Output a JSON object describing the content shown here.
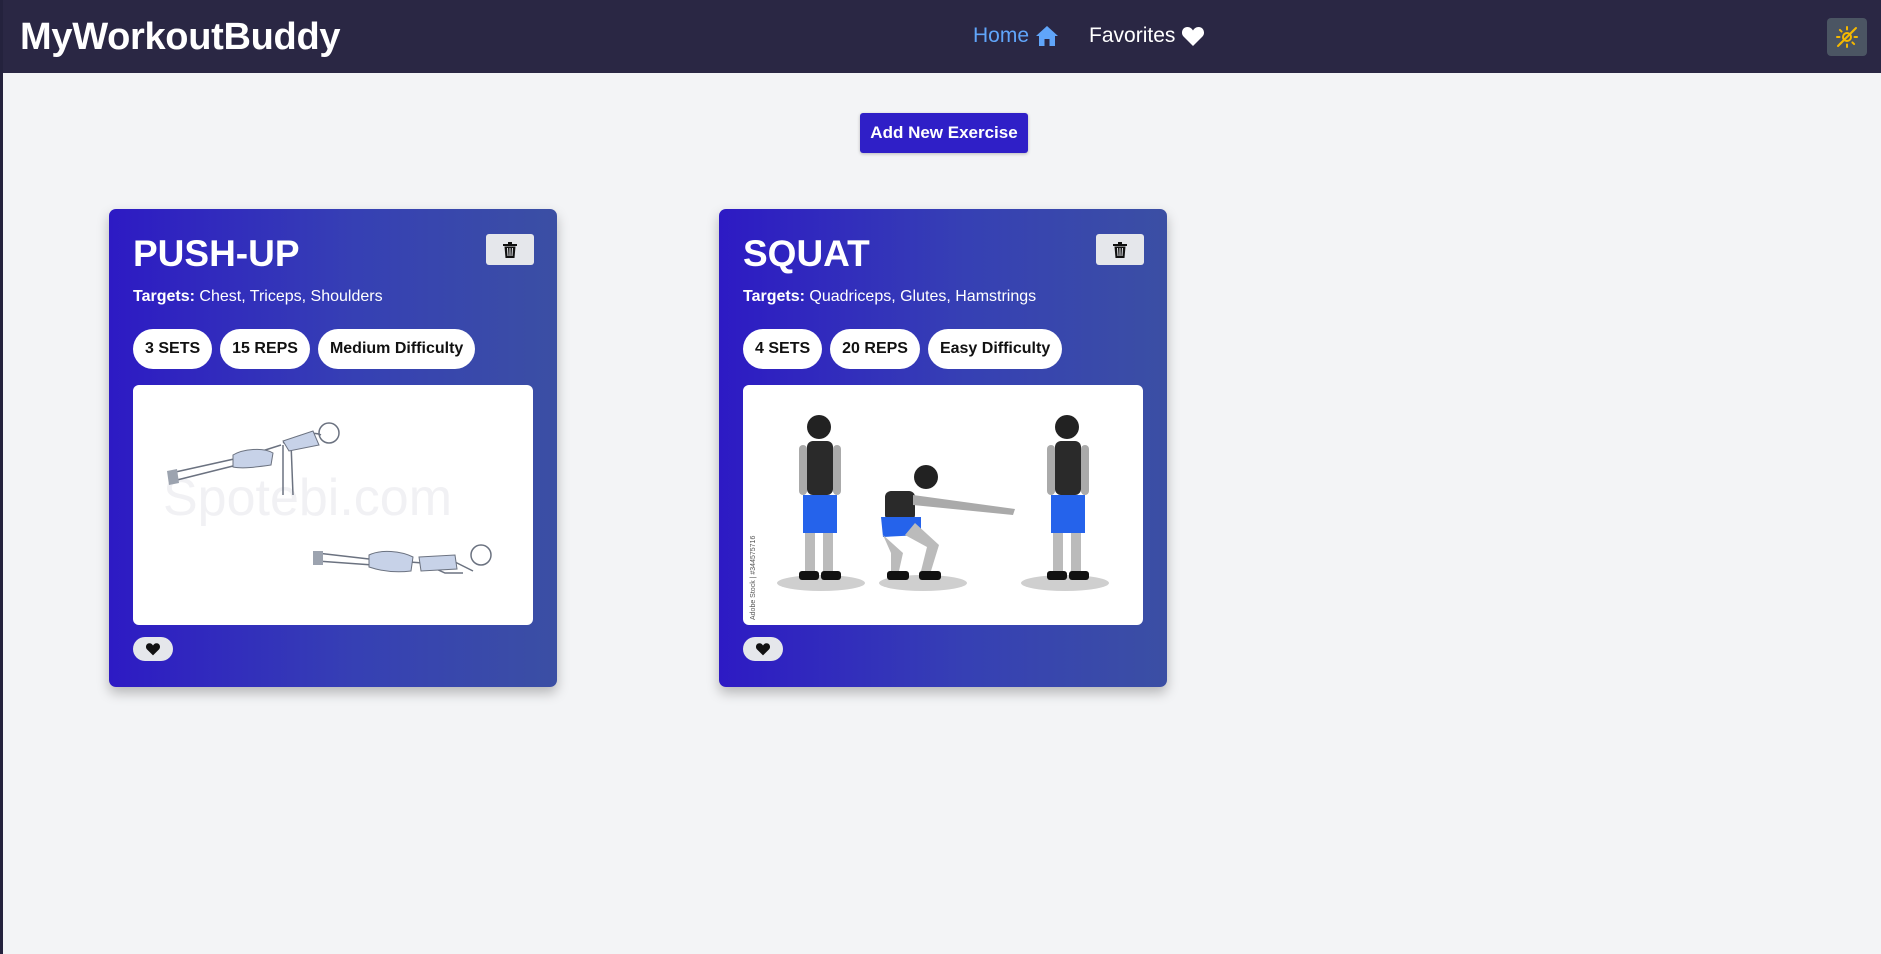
{
  "app": {
    "brand": "MyWorkoutBuddy"
  },
  "nav": {
    "home_label": "Home",
    "favorites_label": "Favorites"
  },
  "actions": {
    "add_label": "Add New Exercise"
  },
  "colors": {
    "navbar": "#2a2744",
    "accent": "#2f1fc7",
    "active_link": "#60a5fa",
    "toggle_icon": "#f5b800"
  },
  "exercises": [
    {
      "name": "PUSH-UP",
      "targets_label": "Targets:",
      "targets": "Chest, Triceps, Shoulders",
      "sets": "3 SETS",
      "reps": "15 REPS",
      "difficulty": "Medium Difficulty",
      "image_watermark": "Spotebi.com"
    },
    {
      "name": "SQUAT",
      "targets_label": "Targets:",
      "targets": "Quadriceps, Glutes, Hamstrings",
      "sets": "4 SETS",
      "reps": "20 REPS",
      "difficulty": "Easy Difficulty",
      "image_watermark": "Adobe Stock | #344575716"
    }
  ],
  "icons": {
    "home": "home-icon",
    "favorites": "heart-icon",
    "theme": "sun-off-icon",
    "delete": "trash-icon",
    "favorite": "heart-icon"
  }
}
